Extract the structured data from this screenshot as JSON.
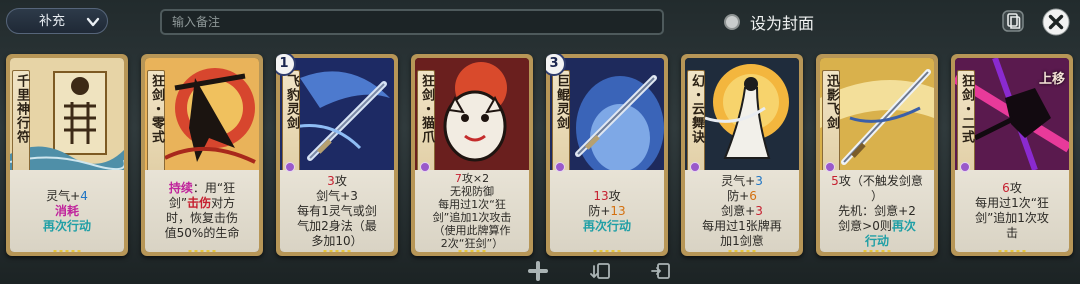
{
  "header": {
    "category_label": "补充",
    "note_placeholder": "输入备注",
    "cover_label": "设为封面"
  },
  "icons": {
    "dropdown": "chevron-down-icon",
    "copy": "copy-icon",
    "close": "close-icon",
    "add": "plus-icon",
    "import": "import-deck-icon",
    "export": "export-deck-icon"
  },
  "colors": {
    "card_frame": "#b79657",
    "qi_blue": "#1f75c4",
    "orange_value": "#d4700f",
    "red_value": "#c62030",
    "keyword_magenta": "#c0249c",
    "keyword_cyan": "#1f9fa6",
    "background": "#2a3335"
  },
  "cards": [
    {
      "name": "千里神行符",
      "badge": "",
      "lines": [
        {
          "parts": [
            {
              "t": "灵气+",
              "c": ""
            },
            {
              "t": "4",
              "c": "num-blue"
            }
          ]
        },
        {
          "parts": [
            {
              "t": "消耗",
              "c": "kw-mag"
            }
          ]
        },
        {
          "parts": [
            {
              "t": "再次行动",
              "c": "kw-cyan"
            }
          ]
        }
      ],
      "dots": 5
    },
    {
      "name": "狂剑・零式",
      "badge": "",
      "lines": [
        {
          "parts": [
            {
              "t": "持续",
              "c": "kw-mag"
            },
            {
              "t": "：用“狂",
              "c": ""
            }
          ]
        },
        {
          "parts": [
            {
              "t": "剑”",
              "c": ""
            },
            {
              "t": "击伤",
              "c": "kw-red"
            },
            {
              "t": "对方",
              "c": ""
            }
          ]
        },
        {
          "parts": [
            {
              "t": "时，恢复击伤",
              "c": ""
            }
          ]
        },
        {
          "parts": [
            {
              "t": "值50%的生命",
              "c": ""
            }
          ]
        }
      ],
      "dots": 5
    },
    {
      "name": "飞豹灵剑",
      "badge": "1",
      "lines": [
        {
          "parts": [
            {
              "t": "3",
              "c": "num-red"
            },
            {
              "t": "攻",
              "c": ""
            }
          ]
        },
        {
          "parts": [
            {
              "t": "剑气+3",
              "c": ""
            }
          ]
        },
        {
          "parts": [
            {
              "t": "每有1灵气或剑",
              "c": ""
            }
          ]
        },
        {
          "parts": [
            {
              "t": "气加2身法（最",
              "c": ""
            }
          ]
        },
        {
          "parts": [
            {
              "t": "多加10）",
              "c": ""
            }
          ]
        }
      ],
      "dots": 5
    },
    {
      "name": "狂剑・猫爪",
      "badge": "",
      "lines": [
        {
          "parts": [
            {
              "t": "7",
              "c": "num-red"
            },
            {
              "t": "攻×2",
              "c": ""
            }
          ]
        },
        {
          "parts": [
            {
              "t": "无视防御",
              "c": ""
            }
          ]
        },
        {
          "parts": [
            {
              "t": "每用过1次“狂",
              "c": ""
            }
          ]
        },
        {
          "parts": [
            {
              "t": "剑”追加1次攻击",
              "c": ""
            }
          ]
        },
        {
          "parts": [
            {
              "t": "（使用此牌算作",
              "c": ""
            }
          ]
        },
        {
          "parts": [
            {
              "t": "2次“狂剑”）",
              "c": ""
            }
          ]
        }
      ],
      "dots": 5
    },
    {
      "name": "巨鲲灵剑",
      "badge": "3",
      "lines": [
        {
          "parts": [
            {
              "t": "13",
              "c": "num-red"
            },
            {
              "t": "攻",
              "c": ""
            }
          ]
        },
        {
          "parts": [
            {
              "t": "防+",
              "c": ""
            },
            {
              "t": "13",
              "c": "num-orange"
            }
          ]
        },
        {
          "parts": [
            {
              "t": "再次行动",
              "c": "kw-cyan"
            }
          ]
        }
      ],
      "dots": 5
    },
    {
      "name": "幻・云舞诀",
      "badge": "",
      "lines": [
        {
          "parts": [
            {
              "t": "灵气+",
              "c": ""
            },
            {
              "t": "3",
              "c": "num-blue"
            }
          ]
        },
        {
          "parts": [
            {
              "t": "防+",
              "c": ""
            },
            {
              "t": "6",
              "c": "num-orange"
            }
          ]
        },
        {
          "parts": [
            {
              "t": "剑意+",
              "c": ""
            },
            {
              "t": "3",
              "c": "num-red"
            }
          ]
        },
        {
          "parts": [
            {
              "t": "每用过1张牌再",
              "c": ""
            }
          ]
        },
        {
          "parts": [
            {
              "t": "加1剑意",
              "c": ""
            }
          ]
        }
      ],
      "dots": 5
    },
    {
      "name": "迅影飞剑",
      "badge": "",
      "lines": [
        {
          "parts": [
            {
              "t": "5",
              "c": "num-red"
            },
            {
              "t": "攻（不触发剑意",
              "c": ""
            }
          ]
        },
        {
          "parts": [
            {
              "t": "）",
              "c": ""
            }
          ]
        },
        {
          "parts": [
            {
              "t": "先机：剑意+2",
              "c": ""
            }
          ]
        },
        {
          "parts": [
            {
              "t": "剑意>0则",
              "c": ""
            },
            {
              "t": "再次",
              "c": "kw-cyan"
            }
          ]
        },
        {
          "parts": [
            {
              "t": "行动",
              "c": "kw-cyan"
            }
          ]
        }
      ],
      "dots": 5
    },
    {
      "name": "狂剑・二式",
      "badge": "",
      "up_label": "上移",
      "lines": [
        {
          "parts": [
            {
              "t": "6",
              "c": "num-red"
            },
            {
              "t": "攻",
              "c": ""
            }
          ]
        },
        {
          "parts": [
            {
              "t": "每用过1次“狂",
              "c": ""
            }
          ]
        },
        {
          "parts": [
            {
              "t": "剑”追加1次攻",
              "c": ""
            }
          ]
        },
        {
          "parts": [
            {
              "t": "击",
              "c": ""
            }
          ]
        }
      ],
      "dots": 5
    }
  ]
}
